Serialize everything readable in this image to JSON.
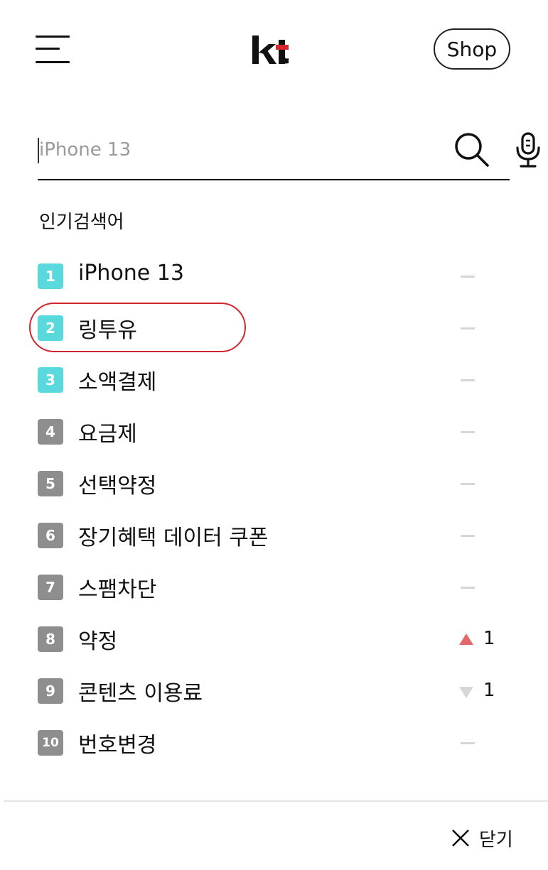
{
  "header": {
    "menu_icon": "hamburger-menu-icon",
    "logo_text": "kt",
    "brand_color": "#d3262c",
    "shop_label": "Shop"
  },
  "search": {
    "placeholder": "iPhone 13",
    "search_icon": "search-icon",
    "mic_icon": "microphone-icon"
  },
  "popular": {
    "title": "인기검색어",
    "items": [
      {
        "rank": "1",
        "term": "iPhone 13",
        "change": "same"
      },
      {
        "rank": "2",
        "term": "링투유",
        "change": "same"
      },
      {
        "rank": "3",
        "term": "소액결제",
        "change": "same"
      },
      {
        "rank": "4",
        "term": "요금제",
        "change": "same"
      },
      {
        "rank": "5",
        "term": "선택약정",
        "change": "same"
      },
      {
        "rank": "6",
        "term": "장기혜택 데이터 쿠폰",
        "change": "same"
      },
      {
        "rank": "7",
        "term": "스팸차단",
        "change": "same"
      },
      {
        "rank": "8",
        "term": "약정",
        "change": "up",
        "change_value": "1"
      },
      {
        "rank": "9",
        "term": "콘텐츠 이용료",
        "change": "down",
        "change_value": "1"
      },
      {
        "rank": "10",
        "term": "번호변경",
        "change": "same"
      }
    ]
  },
  "colors": {
    "rank_top": "#5ad9dc",
    "rank_rest": "#8e8e8e",
    "up": "#e06a6a",
    "down_same": "#d6d6d6",
    "highlight_ring": "#d3262c"
  },
  "footer": {
    "close_label": "닫기",
    "close_icon": "close-icon"
  }
}
